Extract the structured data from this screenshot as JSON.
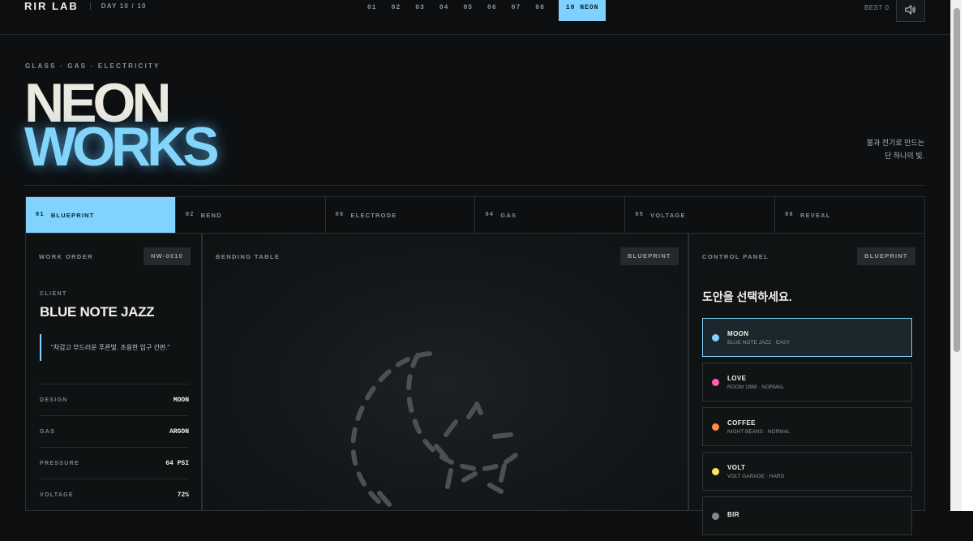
{
  "header": {
    "logo": "RIR LAB",
    "day": "DAY 10 / 10",
    "day_tabs": [
      "01",
      "02",
      "03",
      "04",
      "05",
      "06",
      "07",
      "08",
      "10 NEON"
    ],
    "best": "BEST  0",
    "icons": {
      "sound": "speaker-icon"
    }
  },
  "hero": {
    "eyebrow": "GLASS · GAS · ELECTRICITY",
    "title_line1": "NEON",
    "title_line2": "WORKS",
    "tagline_line1": "불과 전기로 만드는",
    "tagline_line2": "단 하나의 빛."
  },
  "steps": [
    {
      "num": "01",
      "label": "BLUEPRINT"
    },
    {
      "num": "02",
      "label": "BEND"
    },
    {
      "num": "06",
      "label": "ELECTRODE"
    },
    {
      "num": "04",
      "label": "GAS"
    },
    {
      "num": "05",
      "label": "VOLTAGE"
    },
    {
      "num": "06",
      "label": "REVEAL"
    }
  ],
  "work_order": {
    "title": "WORK ORDER",
    "badge": "NW-0010",
    "client_label": "CLIENT",
    "client_name": "BLUE NOTE JAZZ",
    "quote": "\"차갑고 부드러운 푸른빛. 조용한 입구 간판.\"",
    "specs": [
      {
        "key": "DESIGN",
        "value": "MOON"
      },
      {
        "key": "GAS",
        "value": "ARGON"
      },
      {
        "key": "PRESSURE",
        "value": "64 PSI"
      },
      {
        "key": "VOLTAGE",
        "value": "72%"
      }
    ]
  },
  "bending_table": {
    "title": "BENDING TABLE",
    "badge": "BLUEPRINT"
  },
  "control_panel": {
    "title": "CONTROL PANEL",
    "badge": "BLUEPRINT",
    "prompt": "도안을 선택하세요.",
    "options": [
      {
        "name": "MOON",
        "sub": "BLUE NOTE JAZZ · EASY",
        "color": "#7fd2ff"
      },
      {
        "name": "LOVE",
        "sub": "ROOM 1988 · NORMAL",
        "color": "#ff5cae"
      },
      {
        "name": "COFFEE",
        "sub": "NIGHT BEANS · NORMAL",
        "color": "#ff8a4a"
      },
      {
        "name": "VOLT",
        "sub": "VOLT GARAGE · HARD",
        "color": "#ffe45c"
      },
      {
        "name": "BIR",
        "sub": "",
        "color": "#7f8b91"
      }
    ]
  },
  "colors": {
    "accent": "#7fd2ff",
    "background": "#0d0f10"
  }
}
